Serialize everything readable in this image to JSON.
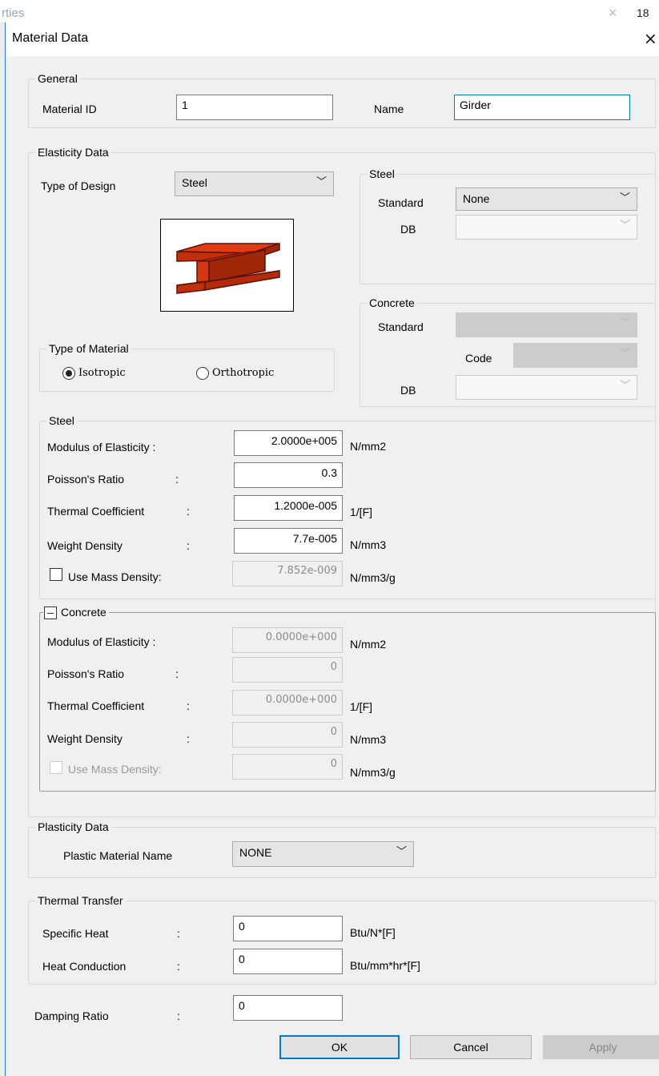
{
  "background_window": {
    "title_fragment": "rties",
    "close": "×",
    "number_fragment": "18"
  },
  "dialog": {
    "title": "Material Data",
    "close": "×"
  },
  "general": {
    "legend": "General",
    "material_id_label": "Material ID",
    "material_id_value": "1",
    "name_label": "Name",
    "name_value": "Girder"
  },
  "elasticity": {
    "legend": "Elasticity Data",
    "type_of_design_label": "Type of Design",
    "type_of_design_value": "Steel",
    "steel_std": {
      "legend": "Steel",
      "standard_label": "Standard",
      "standard_value": "None",
      "db_label": "DB",
      "db_value": ""
    },
    "concrete_std": {
      "legend": "Concrete",
      "standard_label": "Standard",
      "standard_value": "",
      "code_label": "Code",
      "code_value": "",
      "db_label": "DB",
      "db_value": ""
    },
    "type_of_material": {
      "legend": "Type of Material",
      "isotropic": "Isotropic",
      "orthotropic": "Orthotropic",
      "selected": "Isotropic"
    },
    "steel": {
      "legend": "Steel",
      "modulus_label": "Modulus of Elasticity :",
      "modulus_value": "2.0000e+005",
      "modulus_unit": "N/mm2",
      "poisson_label": "Poisson's Ratio",
      "poisson_value": "0.3",
      "thermal_label": "Thermal Coefficient",
      "thermal_value": "1.2000e-005",
      "thermal_unit": "1/[F]",
      "weight_label": "Weight Density",
      "weight_value": "7.7e-005",
      "weight_unit": "N/mm3",
      "mass_label": "Use Mass Density:",
      "mass_value": "7.852e-009",
      "mass_unit": "N/mm3/g",
      "colon": ":"
    },
    "concrete": {
      "legend": "Concrete",
      "modulus_label": "Modulus of Elasticity :",
      "modulus_value": "0.0000e+000",
      "modulus_unit": "N/mm2",
      "poisson_label": "Poisson's Ratio",
      "poisson_value": "0",
      "thermal_label": "Thermal Coefficient",
      "thermal_value": "0.0000e+000",
      "thermal_unit": "1/[F]",
      "weight_label": "Weight Density",
      "weight_value": "0",
      "weight_unit": "N/mm3",
      "mass_label": "Use Mass Density:",
      "mass_value": "0",
      "mass_unit": "N/mm3/g",
      "colon": ":"
    }
  },
  "plasticity": {
    "legend": "Plasticity Data",
    "name_label": "Plastic Material Name",
    "name_value": "NONE"
  },
  "thermal_transfer": {
    "legend": "Thermal Transfer",
    "specific_heat_label": "Specific Heat",
    "specific_heat_value": "0",
    "specific_heat_unit": "Btu/N*[F]",
    "heat_conduction_label": "Heat Conduction",
    "heat_conduction_value": "0",
    "heat_conduction_unit": "Btu/mm*hr*[F]",
    "colon": ":"
  },
  "damping": {
    "label": "Damping Ratio",
    "value": "0",
    "colon": ":"
  },
  "buttons": {
    "ok": "OK",
    "cancel": "Cancel",
    "apply": "Apply"
  },
  "colors": {
    "accent": "#0078d7",
    "material_fill": "#e23a12",
    "material_outline": "#5a1200"
  }
}
